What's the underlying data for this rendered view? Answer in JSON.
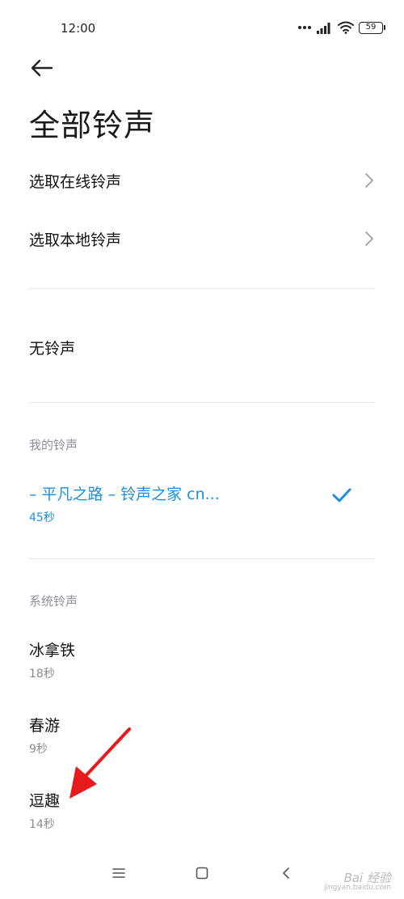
{
  "status_bar": {
    "time": "12:00",
    "battery_level": "59",
    "icons": [
      "more-dots-icon",
      "signal-icon",
      "wifi-icon",
      "battery-icon"
    ]
  },
  "header": {
    "back_icon": "arrow-left-icon",
    "title": "全部铃声"
  },
  "options": [
    {
      "label": "选取在线铃声",
      "icon": "chevron-right-icon"
    },
    {
      "label": "选取本地铃声",
      "icon": "chevron-right-icon"
    }
  ],
  "no_ringtone": {
    "label": "无铃声"
  },
  "my_ringtones": {
    "header": "我的铃声",
    "items": [
      {
        "name": "– 平凡之路 – 铃声之家 cn...",
        "duration": "45秒",
        "selected": true
      }
    ]
  },
  "system_ringtones": {
    "header": "系统铃声",
    "items": [
      {
        "name": "冰拿铁",
        "duration": "18秒"
      },
      {
        "name": "春游",
        "duration": "9秒"
      },
      {
        "name": "逗趣",
        "duration": "14秒"
      }
    ]
  },
  "nav_bar": {
    "icons": [
      "menu-icon",
      "home-icon",
      "back-icon"
    ]
  },
  "watermark": {
    "text": "Bai 经验",
    "sub": "jingyan.baidu.com"
  },
  "colors": {
    "accent": "#1a8fe0",
    "annotation_arrow": "#e8191c"
  }
}
